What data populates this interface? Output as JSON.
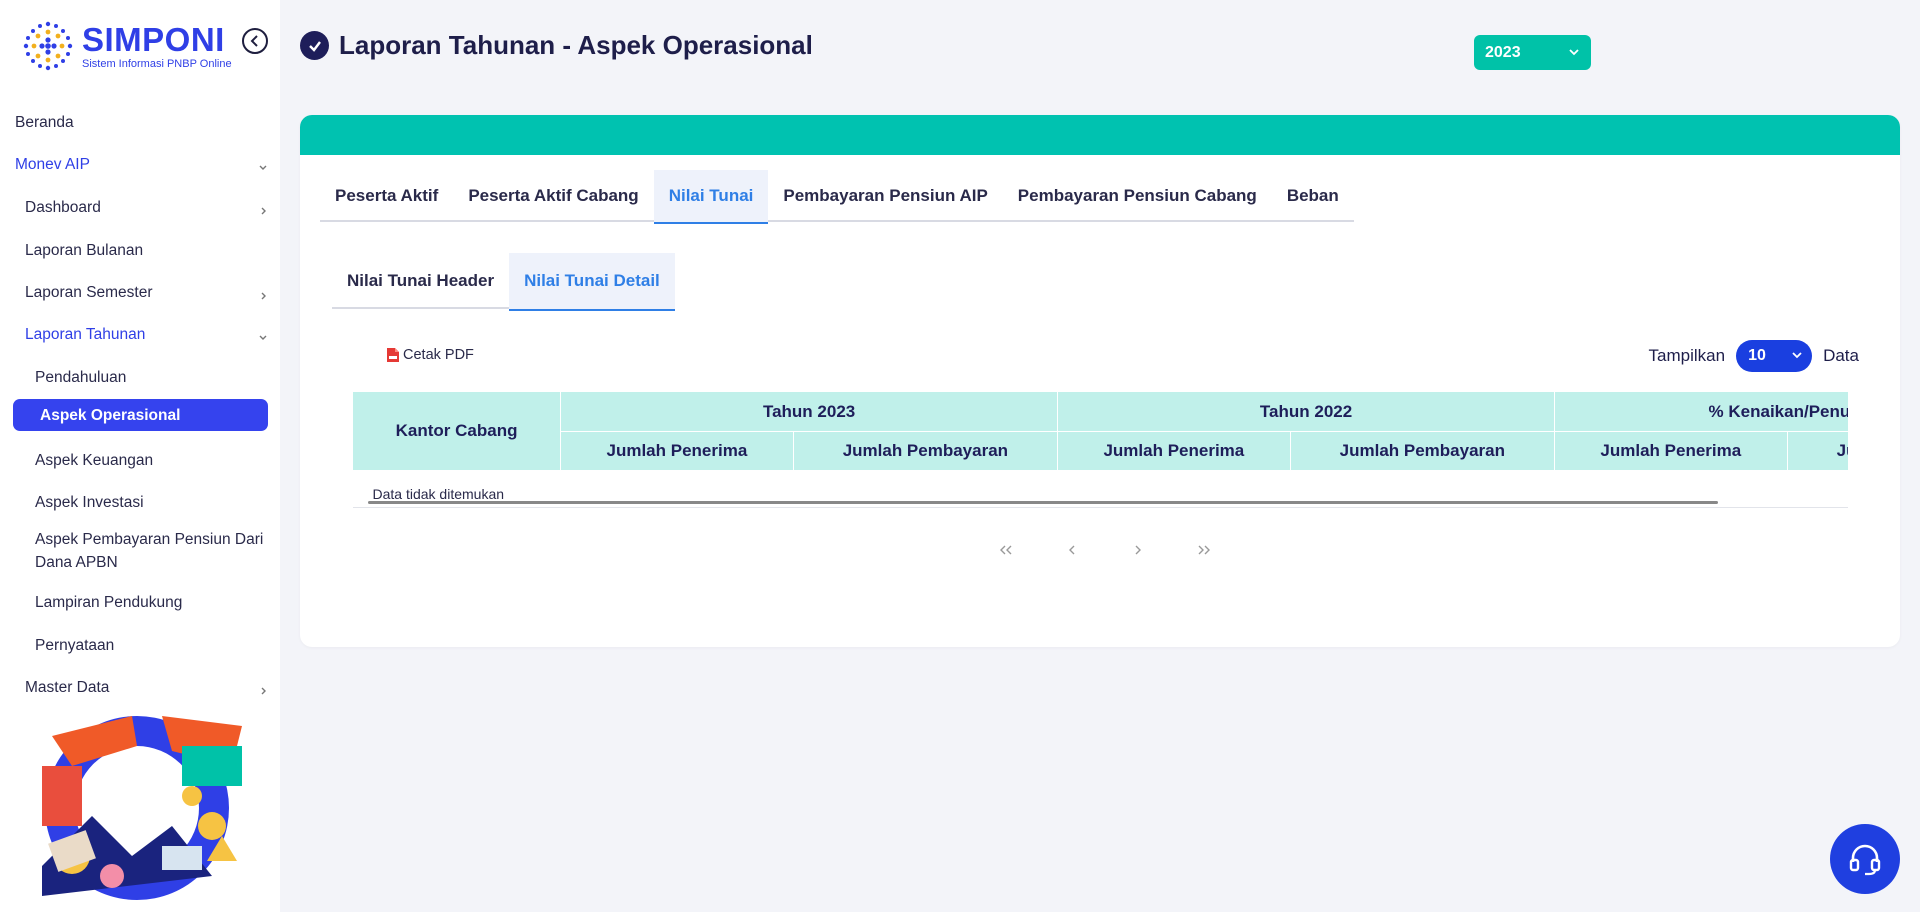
{
  "app": {
    "logo_title": "SIMPONI",
    "logo_subtitle": "Sistem Informasi PNBP Online"
  },
  "sidebar": {
    "items": [
      {
        "label": "Beranda"
      },
      {
        "label": "Monev AIP"
      },
      {
        "label": "Dashboard"
      },
      {
        "label": "Laporan Bulanan"
      },
      {
        "label": "Laporan Semester"
      },
      {
        "label": "Laporan Tahunan"
      },
      {
        "label": "Pendahuluan"
      },
      {
        "label": "Aspek Operasional"
      },
      {
        "label": "Aspek Keuangan"
      },
      {
        "label": "Aspek Investasi"
      },
      {
        "label": "Aspek Pembayaran Pensiun Dari Dana APBN"
      },
      {
        "label": "Lampiran Pendukung"
      },
      {
        "label": "Pernyataan"
      },
      {
        "label": "Master Data"
      }
    ]
  },
  "header": {
    "title": "Laporan Tahunan - Aspek Operasional",
    "year_selected": "2023"
  },
  "tabs": [
    {
      "label": "Peserta Aktif",
      "active": false
    },
    {
      "label": "Peserta Aktif Cabang",
      "active": false
    },
    {
      "label": "Nilai Tunai",
      "active": true
    },
    {
      "label": "Pembayaran Pensiun AIP",
      "active": false
    },
    {
      "label": "Pembayaran Pensiun Cabang",
      "active": false
    },
    {
      "label": "Beban",
      "active": false
    }
  ],
  "subtabs": [
    {
      "label": "Nilai Tunai Header",
      "active": false
    },
    {
      "label": "Nilai Tunai Detail",
      "active": true
    }
  ],
  "toolbar": {
    "pdf_label": "Cetak PDF",
    "show_label": "Tampilkan",
    "show_value": "10",
    "show_suffix": "Data"
  },
  "table": {
    "first_col": "Kantor Cabang",
    "groups": [
      "Tahun 2023",
      "Tahun 2022",
      "% Kenaikan/Penurunan"
    ],
    "sub_columns": [
      "Jumlah Penerima",
      "Jumlah Pembayaran",
      "Jumlah Penerima",
      "Jumlah Pembayaran",
      "Jumlah Penerima",
      "Jumlah Pembayaran"
    ],
    "empty_message": "Data tidak ditemukan"
  },
  "pagination": {
    "first": "«",
    "prev": "‹",
    "next": "›",
    "last": "»"
  },
  "colors": {
    "primary": "#2f3fe6",
    "teal": "#00c2b0",
    "header_cell": "#c0f0ea",
    "active_tab": "#2f7fe6"
  }
}
